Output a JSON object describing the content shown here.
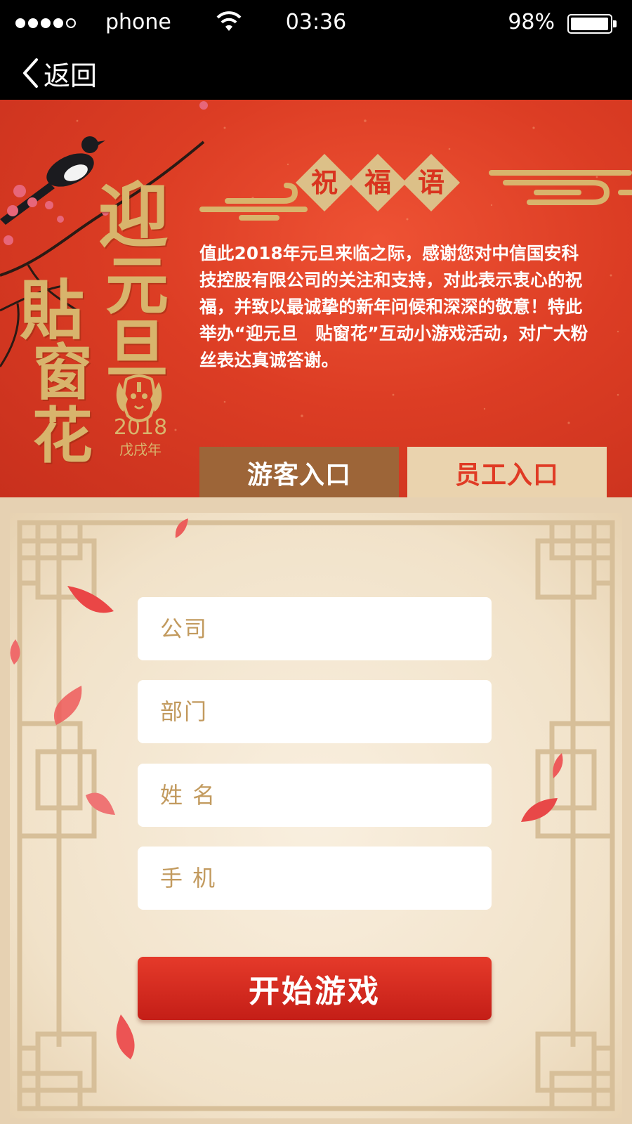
{
  "status_bar": {
    "carrier": "phone",
    "time": "03:36",
    "battery": "98%",
    "battery_level": 0.98
  },
  "nav": {
    "back_label": "返回"
  },
  "banner": {
    "title_chars": [
      "迎",
      "元",
      "旦",
      "貼",
      "窗",
      "花"
    ],
    "year": "2018",
    "year_sub": "戊戌年",
    "blessing_title": [
      "祝",
      "福",
      "语"
    ],
    "blessing_text": "值此2018年元旦来临之际，感谢您对中信国安科技控股有限公司的关注和支持，对此表示衷心的祝福，并致以最诚挚的新年问候和深深的敬意！特此举办“迎元旦　贴窗花”互动小游戏活动，对广大粉丝表达真诚答谢。"
  },
  "tabs": {
    "guest": "游客入口",
    "staff": "员工入口"
  },
  "form": {
    "company_placeholder": "公司",
    "department_placeholder": "部门",
    "name_placeholder": "姓 名",
    "phone_placeholder": "手 机",
    "start_button": "开始游戏"
  },
  "colors": {
    "banner_red": "#dc3d24",
    "gold": "#d8b46c",
    "tab_brown": "#9d6538",
    "tab_beige": "#ead3ae",
    "button_red": "#d42a1f"
  }
}
